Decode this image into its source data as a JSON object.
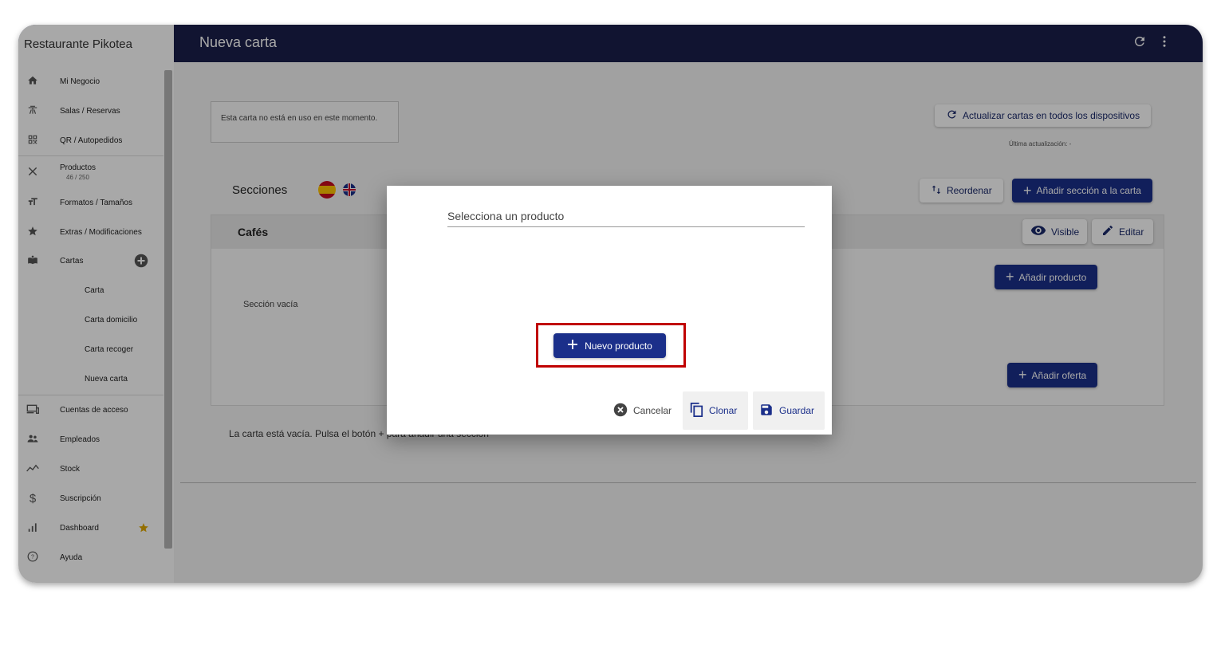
{
  "app": {
    "brand": "Restaurante Pikotea",
    "page_title": "Nueva carta",
    "refresh_icon": "refresh-icon",
    "more_icon": "more-vert-icon"
  },
  "sidebar": {
    "items": [
      {
        "label": "Mi Negocio",
        "icon": "home-icon"
      },
      {
        "label": "Salas / Reservas",
        "icon": "table-icon"
      },
      {
        "label": "QR / Autopedidos",
        "icon": "qr-icon"
      },
      {
        "label": "Productos",
        "sub": "46 / 250",
        "icon": "utensils-icon"
      },
      {
        "label": "Formatos / Tamaños",
        "icon": "text-size-icon"
      },
      {
        "label": "Extras / Modificaciones",
        "icon": "star-icon"
      },
      {
        "label": "Cartas",
        "icon": "menu-book-icon"
      },
      {
        "label": "Carta"
      },
      {
        "label": "Carta domicilio"
      },
      {
        "label": "Carta recoger"
      },
      {
        "label": "Nueva carta"
      },
      {
        "label": "Cuentas de acceso",
        "icon": "devices-icon"
      },
      {
        "label": "Empleados",
        "icon": "people-icon"
      },
      {
        "label": "Stock",
        "icon": "trend-icon"
      },
      {
        "label": "Suscripción",
        "icon": "dollar-icon"
      },
      {
        "label": "Dashboard",
        "icon": "bar-chart-icon"
      },
      {
        "label": "Ayuda",
        "icon": "help-icon"
      }
    ]
  },
  "main": {
    "status_text": "Esta carta no está en uso en este momento.",
    "update_all_label": "Actualizar cartas en todos los dispositivos",
    "last_update_label": "Última actualización: -",
    "sections_title": "Secciones",
    "reorder_label": "Reordenar",
    "add_section_label": "Añadir sección a la carta",
    "section_name": "Cafés",
    "visible_label": "Visible",
    "edit_label": "Editar",
    "add_product_label": "Añadir producto",
    "empty_section_label": "Sección vacía",
    "add_offer_label": "Añadir oferta",
    "empty_menu_text": "La carta está vacía. Pulsa el botón + para añadir una sección"
  },
  "dialog": {
    "select_placeholder": "Selecciona un producto",
    "new_product_label": "Nuevo producto",
    "cancel_label": "Cancelar",
    "clone_label": "Clonar",
    "save_label": "Guardar"
  },
  "colors": {
    "primary": "#1b2f8a",
    "appbar": "#1b1f4b",
    "highlight": "#c00000"
  }
}
